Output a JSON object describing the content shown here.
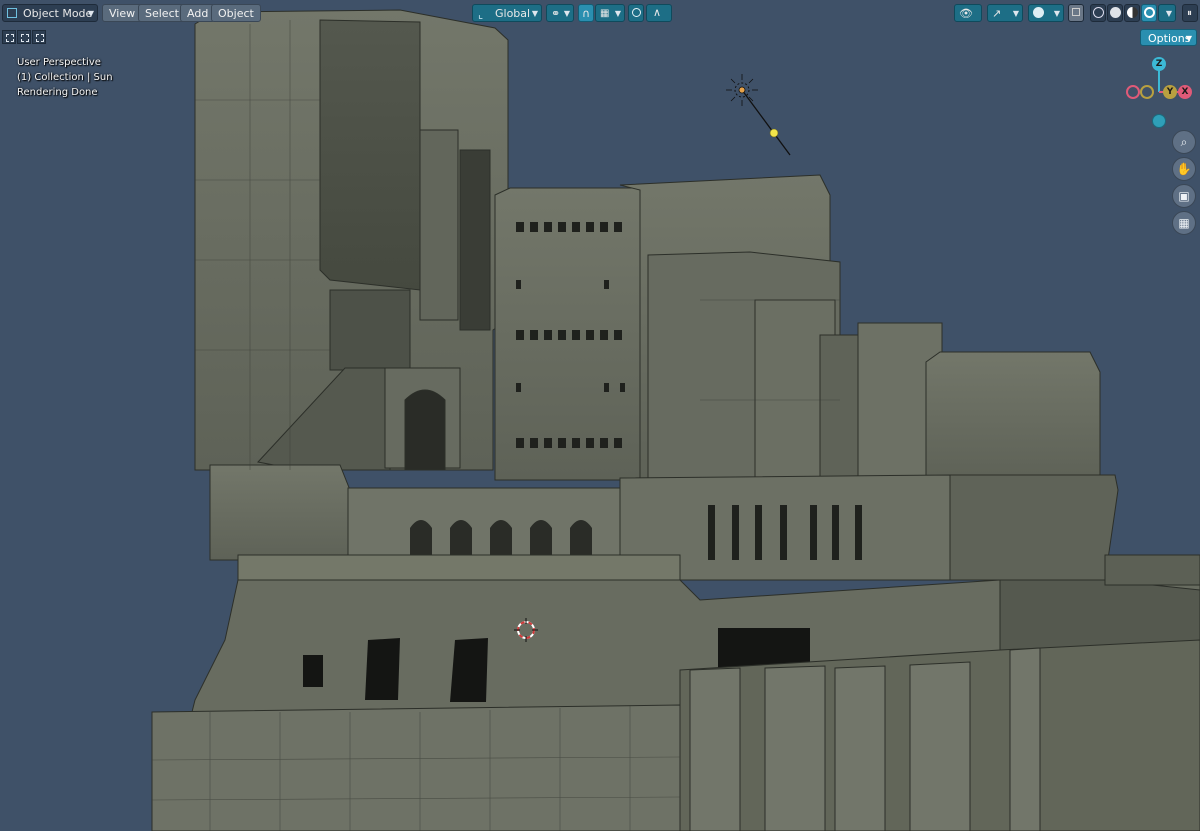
{
  "header": {
    "mode_label": "Object Mode",
    "menu": [
      "View",
      "Select",
      "Add",
      "Object"
    ],
    "transform_orientation": "Global",
    "options_label": "Options"
  },
  "overlay": {
    "view_name": "User Perspective",
    "collection_info": "(1) Collection | Sun",
    "status": "Rendering Done"
  },
  "gizmo": {
    "z": "Z",
    "y": "Y",
    "x": "X"
  },
  "colors": {
    "viewport_bg": "#3f5168",
    "accent": "#2a8fb0",
    "building": "#6a6e62",
    "x_axis": "#e05a78",
    "y_axis": "#b8a040",
    "z_axis": "#3cb9d6"
  },
  "icons": {
    "mode": "object-mode-icon",
    "orientation": "transform-orientation-icon",
    "pivot": "pivot-icon",
    "snap": "magnet-icon",
    "proportional": "proportional-editing-icon",
    "visibility": "eye-icon",
    "gizmos": "gizmo-icon",
    "overlays": "overlay-icon",
    "xray": "xray-icon",
    "shading": [
      "wireframe-icon",
      "solid-icon",
      "material-icon",
      "rendered-icon"
    ],
    "nav": [
      "zoom-icon",
      "hand-pan-icon",
      "camera-icon",
      "grid-perspective-icon"
    ]
  }
}
